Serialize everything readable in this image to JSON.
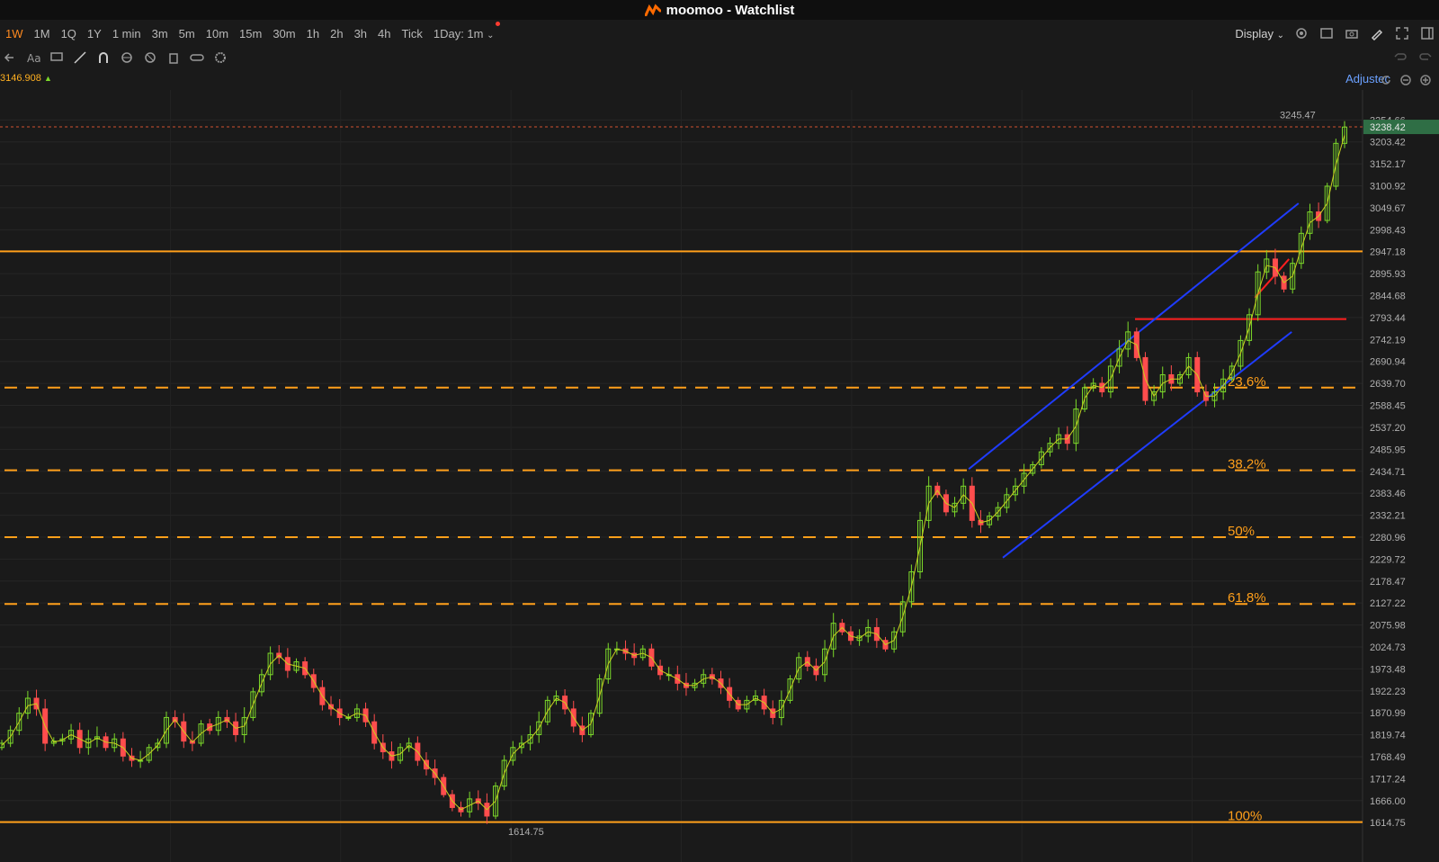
{
  "window": {
    "title": "moomoo - Watchlist"
  },
  "toolbar": {
    "timeframes": [
      "1W",
      "1M",
      "1Q",
      "1Y",
      "1 min",
      "3m",
      "5m",
      "10m",
      "15m",
      "30m",
      "1h",
      "2h",
      "3h",
      "4h",
      "Tick",
      "1Day: 1m"
    ],
    "active_timeframe": "1W",
    "display_label": "Display"
  },
  "infobar": {
    "price_readout": "3146.908",
    "adjusted_label": "Adjustec"
  },
  "colors": {
    "background": "#1a1a1a",
    "accent": "#ff8a1f",
    "up": "#7cd92a",
    "down": "#ff4d4d",
    "channel": "#1f3cff",
    "fib": "#ff9f1a",
    "resistance": "#ff1f1f"
  },
  "icons": [
    "logo-icon",
    "settings-icon",
    "layout-icon",
    "camera-icon",
    "pen-icon",
    "fullscreen-icon",
    "sidebar-icon",
    "undo-icon",
    "redo-icon",
    "chevron-icon",
    "back-arrow-icon",
    "text-icon",
    "comment-icon",
    "line-icon",
    "magnet-icon",
    "lock-icon",
    "hide-icon",
    "trash-icon",
    "link-icon",
    "gear-icon",
    "reset-icon",
    "zoom-out-icon",
    "zoom-in-icon"
  ],
  "chart_data": {
    "type": "candlestick",
    "y_axis": {
      "ticks": [
        "3254.66",
        "3203.42",
        "3152.17",
        "3100.92",
        "3049.67",
        "2998.43",
        "2947.18",
        "2895.93",
        "2844.68",
        "2793.44",
        "2742.19",
        "2690.94",
        "2639.70",
        "2588.45",
        "2537.20",
        "2485.95",
        "2434.71",
        "2383.46",
        "2332.21",
        "2280.96",
        "2229.72",
        "2178.47",
        "2127.22",
        "2075.98",
        "2024.73",
        "1973.48",
        "1922.23",
        "1870.99",
        "1819.74",
        "1768.49",
        "1717.24",
        "1666.00",
        "1614.75"
      ],
      "range": [
        1590,
        3270
      ]
    },
    "current_price_label": "3238.42",
    "current_price": 3238.42,
    "high_label": "3245.47",
    "high": 3245.47,
    "low_label": "1614.75",
    "low": 1614.75,
    "fib_levels": [
      {
        "label": "23.6%",
        "value": 2630
      },
      {
        "label": "38.2%",
        "value": 2437
      },
      {
        "label": "50%",
        "value": 2281
      },
      {
        "label": "61.8%",
        "value": 2125
      },
      {
        "label": "100%",
        "value": 1616
      }
    ],
    "horizontal_lines": [
      {
        "value": 2948,
        "style": "solid"
      },
      {
        "value": 1616,
        "style": "solid"
      }
    ],
    "resistance_line": {
      "value": 2790
    },
    "channel": {
      "upper": [
        [
          0.711,
          2440
        ],
        [
          0.953,
          3060
        ]
      ],
      "lower": [
        [
          0.736,
          2233
        ],
        [
          0.948,
          2760
        ]
      ]
    },
    "small_trend": [
      [
        0.921,
        2840
      ],
      [
        0.946,
        2930
      ]
    ],
    "series": [
      1800,
      1830,
      1870,
      1905,
      1880,
      1800,
      1805,
      1810,
      1830,
      1790,
      1810,
      1815,
      1790,
      1810,
      1770,
      1760,
      1760,
      1790,
      1800,
      1860,
      1850,
      1805,
      1800,
      1845,
      1830,
      1860,
      1850,
      1820,
      1860,
      1920,
      1960,
      2010,
      2000,
      1970,
      1990,
      1960,
      1930,
      1890,
      1880,
      1860,
      1860,
      1880,
      1850,
      1800,
      1780,
      1760,
      1790,
      1800,
      1760,
      1740,
      1720,
      1680,
      1650,
      1640,
      1670,
      1660,
      1630,
      1700,
      1760,
      1790,
      1800,
      1820,
      1850,
      1900,
      1910,
      1880,
      1840,
      1820,
      1870,
      1950,
      2020,
      2020,
      2010,
      2000,
      2020,
      1980,
      1960,
      1960,
      1940,
      1930,
      1940,
      1960,
      1950,
      1930,
      1900,
      1880,
      1900,
      1910,
      1880,
      1860,
      1900,
      1950,
      2000,
      1980,
      1960,
      2020,
      2080,
      2060,
      2040,
      2050,
      2070,
      2040,
      2020,
      2060,
      2130,
      2200,
      2320,
      2400,
      2380,
      2340,
      2360,
      2400,
      2320,
      2310,
      2330,
      2350,
      2380,
      2400,
      2430,
      2450,
      2480,
      2500,
      2520,
      2500,
      2580,
      2630,
      2640,
      2620,
      2680,
      2720,
      2760,
      2700,
      2600,
      2620,
      2660,
      2640,
      2660,
      2700,
      2620,
      2600,
      2620,
      2650,
      2680,
      2740,
      2800,
      2900,
      2930,
      2890,
      2860,
      2920,
      2990,
      3040,
      3020,
      3100,
      3200,
      3238
    ]
  }
}
